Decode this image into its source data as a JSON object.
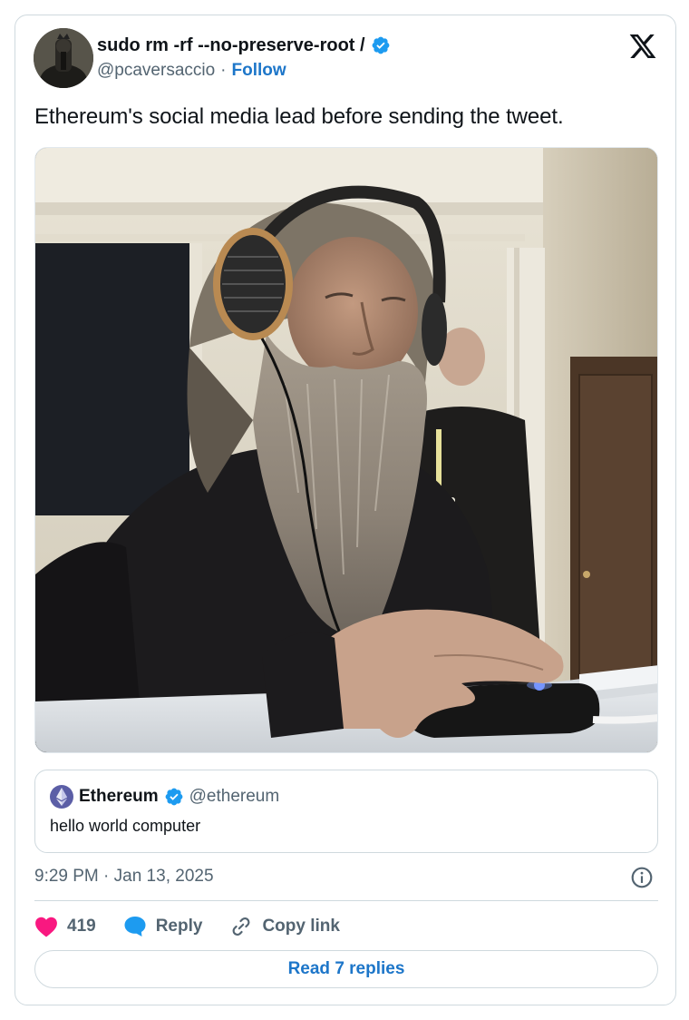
{
  "author": {
    "display_name": "sudo rm -rf --no-preserve-root /",
    "handle": "@pcaversaccio",
    "separator": "·",
    "follow_label": "Follow"
  },
  "tweet": {
    "text": "Ethereum's social media lead before sending the tweet."
  },
  "quote": {
    "display_name": "Ethereum",
    "handle": "@ethereum",
    "text": "hello world computer"
  },
  "meta": {
    "timestamp": "9:29 PM · Jan 13, 2025"
  },
  "actions": {
    "likes_count": "419",
    "reply_label": "Reply",
    "copy_link_label": "Copy link",
    "read_replies_label": "Read 7 replies"
  },
  "colors": {
    "link_blue": "#1d76c9",
    "like_pink": "#f91880",
    "verified_blue": "#1d9bf0",
    "muted_gray": "#536471",
    "border_gray": "#cfd9de"
  },
  "icons": [
    "x-logo-icon",
    "verified-badge-icon",
    "heart-icon",
    "reply-bubble-icon",
    "link-icon",
    "info-icon",
    "ethereum-logo-icon"
  ]
}
